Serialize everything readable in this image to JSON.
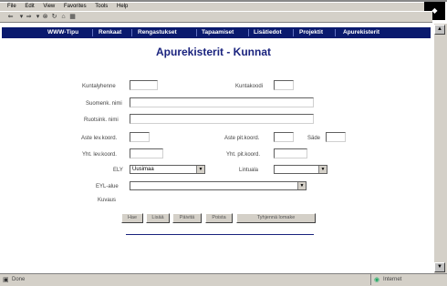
{
  "menubar": {
    "items": [
      "File",
      "Edit",
      "View",
      "Favorites",
      "Tools",
      "Help"
    ]
  },
  "nav": {
    "items": [
      "WWW-Tipu",
      "Renkaat",
      "Rengastukset",
      "Tapaamiset",
      "Lisätiedot",
      "Projektit",
      "Apurekisterit"
    ]
  },
  "page": {
    "title": "Apurekisterit - Kunnat"
  },
  "form": {
    "kunta_lyhenne": "Kuntalyhenne",
    "kuntakoodi": "Kuntakoodi",
    "suomi_nimi": "Suomenk. nimi",
    "ruotsi_nimi": "Ruotsink. nimi",
    "aste_lev_koord": "Aste lev.koord.",
    "aste_pit_koord": "Aste pit.koord.",
    "sade": "Säde",
    "yht_lev_koord": "Yht. lev.koord.",
    "yht_pit_koord": "Yht. pit.koord.",
    "ely_label": "ELY",
    "ely_value": "Uusimaa",
    "lintuala_label": "Lintuala",
    "lintuala_value": "",
    "eyl_label": "EYL-alue",
    "eyl_value": "",
    "kuvaus": "Kuvaus"
  },
  "buttons": {
    "b1": "Hae",
    "b2": "Lisää",
    "b3": "Päivitä",
    "b4": "Poista",
    "b5": "Tyhjennä lomake"
  },
  "status": {
    "left": "Done",
    "right": "Internet"
  }
}
